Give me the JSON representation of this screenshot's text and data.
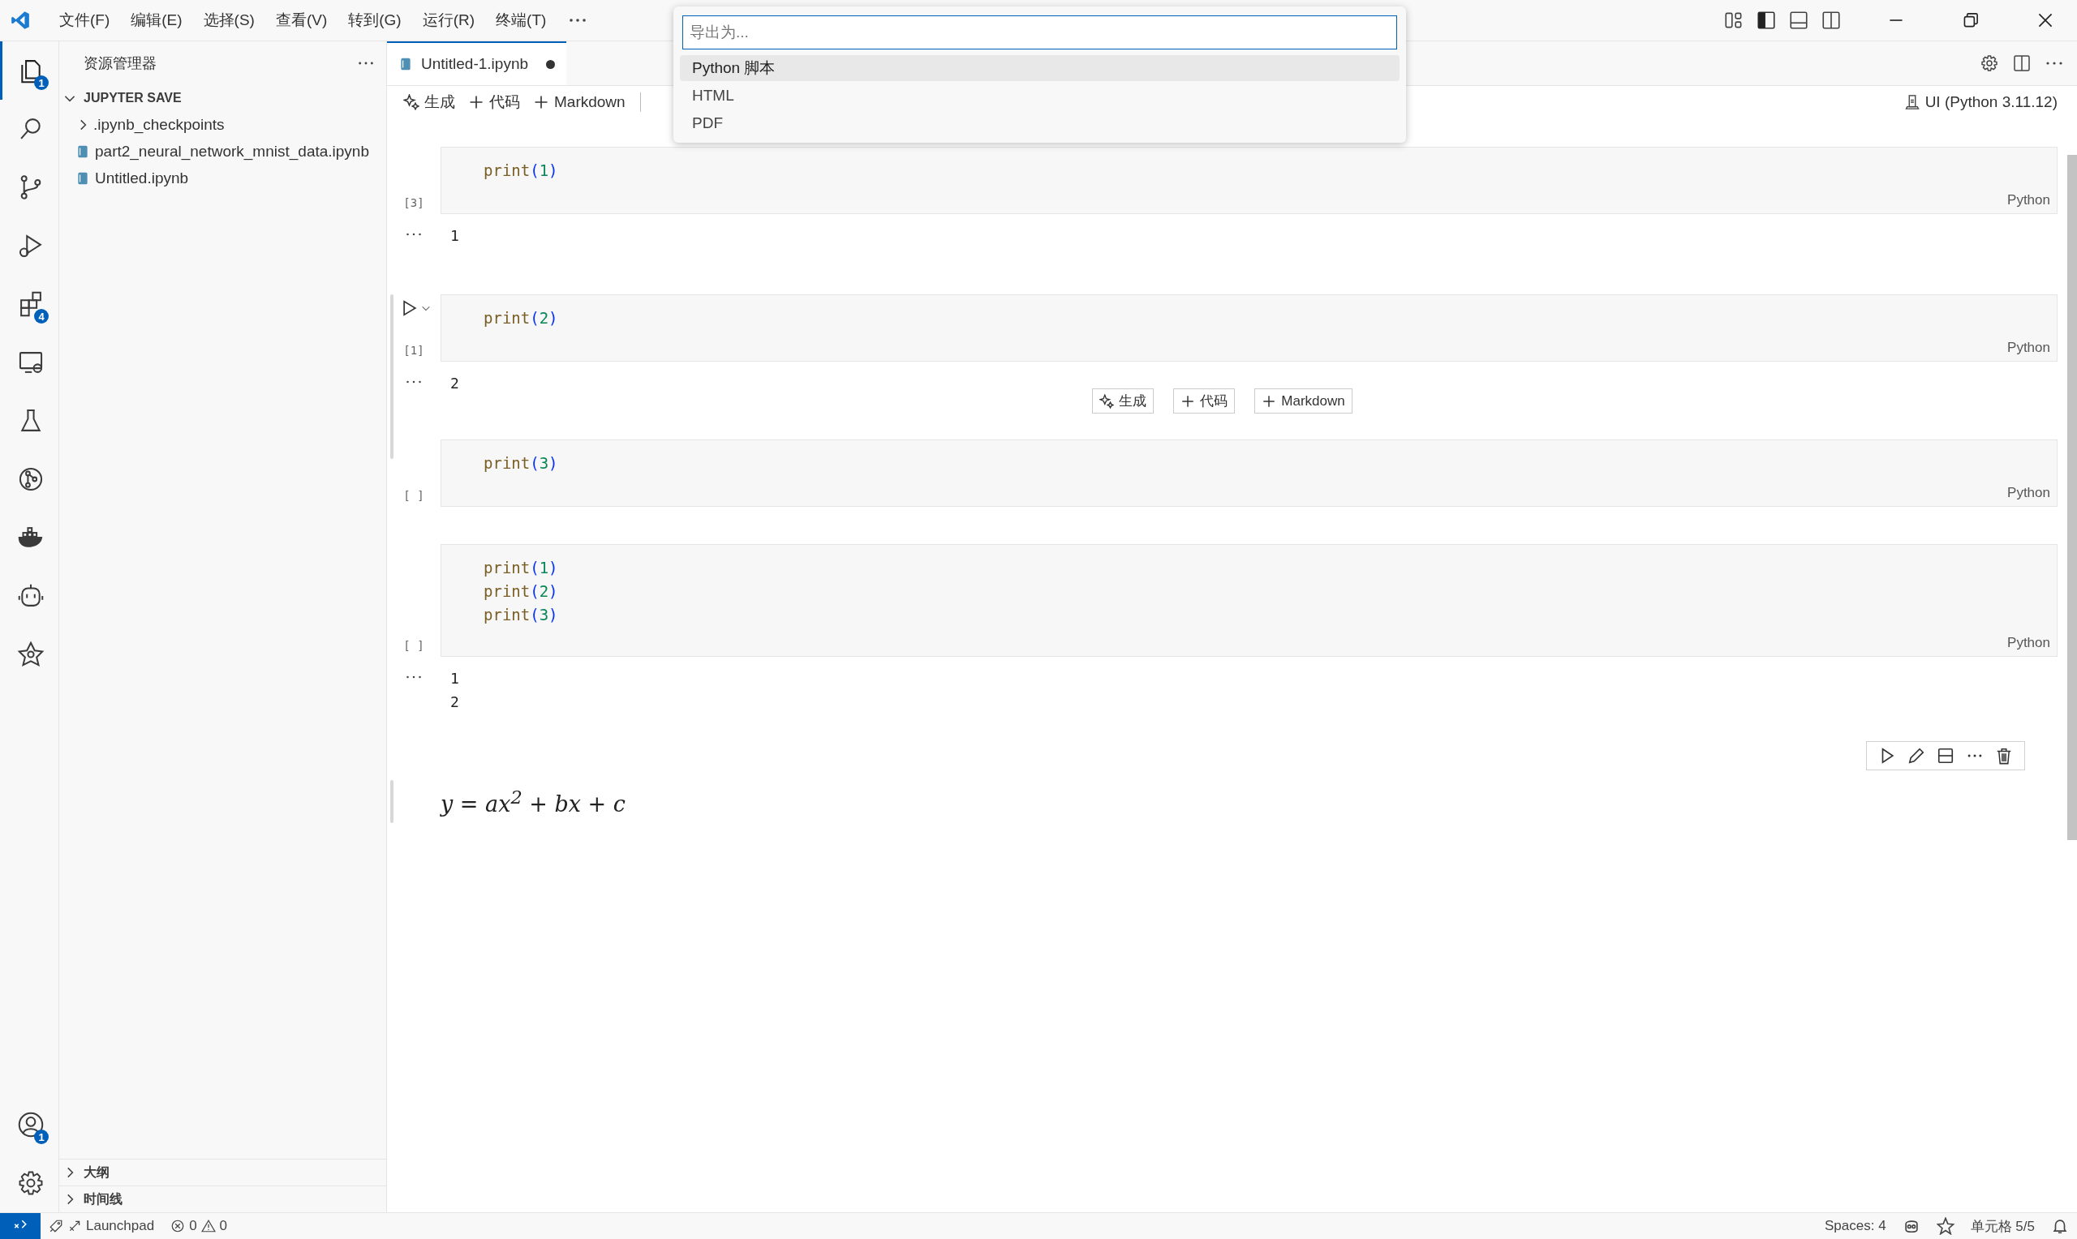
{
  "menu_bar": [
    "文件(F)",
    "编辑(E)",
    "选择(S)",
    "查看(V)",
    "转到(G)",
    "运行(R)",
    "终端(T)"
  ],
  "activity_bar": {
    "items": [
      {
        "selected": true,
        "badge": "1"
      },
      {
        "selected": false
      },
      {
        "selected": false
      },
      {
        "selected": false
      },
      {
        "selected": false,
        "badge": "4"
      },
      {
        "selected": false
      },
      {
        "selected": false
      },
      {
        "selected": false
      },
      {
        "selected": false
      },
      {
        "selected": false
      },
      {
        "selected": false
      }
    ],
    "accounts_badge": "1"
  },
  "sidebar": {
    "title": "资源管理器",
    "section": {
      "label": "JUPYTER SAVE",
      "expanded": true
    },
    "tree": [
      {
        "label": ".ipynb_checkpoints",
        "kind": "folder",
        "expanded": false
      },
      {
        "label": "part2_neural_network_mnist_data.ipynb",
        "kind": "notebook"
      },
      {
        "label": "Untitled.ipynb",
        "kind": "notebook"
      }
    ],
    "bottom_sections": [
      {
        "label": "大纲",
        "expanded": false
      },
      {
        "label": "时间线",
        "expanded": false
      }
    ]
  },
  "tabs": [
    {
      "label": "Untitled-1.ipynb",
      "selected": true,
      "modified": true
    }
  ],
  "notebook_toolbar": [
    {
      "label": "生成",
      "kind": "generate"
    },
    {
      "label": "代码",
      "kind": "add"
    },
    {
      "label": "Markdown",
      "kind": "add"
    }
  ],
  "kernel": "UI (Python 3.11.12)",
  "quick_pick": {
    "placeholder": "导出为...",
    "items": [
      {
        "label": "Python 脚本",
        "selected": true
      },
      {
        "label": "HTML",
        "selected": false
      },
      {
        "label": "PDF",
        "selected": false
      }
    ]
  },
  "cells": [
    {
      "kind": "code",
      "lines": [
        "print(1)"
      ],
      "execution": "[3]",
      "language": "Python",
      "output": [
        "1"
      ],
      "hovered": false
    },
    {
      "kind": "code",
      "lines": [
        "print(2)"
      ],
      "execution": "[1]",
      "language": "Python",
      "output": [
        "2"
      ],
      "hovered": true,
      "insert_toolbar": [
        {
          "label": "生成",
          "kind": "generate"
        },
        {
          "label": "代码",
          "kind": "add"
        },
        {
          "label": "Markdown",
          "kind": "add"
        }
      ]
    },
    {
      "kind": "code",
      "lines": [
        "print(3)"
      ],
      "execution": "[ ]",
      "language": "Python",
      "hovered": false
    },
    {
      "kind": "code",
      "lines": [
        "print(1)",
        "print(2)",
        "print(3)"
      ],
      "execution": "[ ]",
      "language": "Python",
      "output": [
        "1",
        "2"
      ],
      "hovered": false
    },
    {
      "kind": "markdown",
      "formula": "y = ax$^{2}$ + bx + c",
      "selected": true
    }
  ],
  "status_bar": {
    "launchpad": "Launchpad",
    "errors": "0",
    "warnings": "0",
    "spaces": "Spaces: 4",
    "cell": "单元格 5/5"
  }
}
